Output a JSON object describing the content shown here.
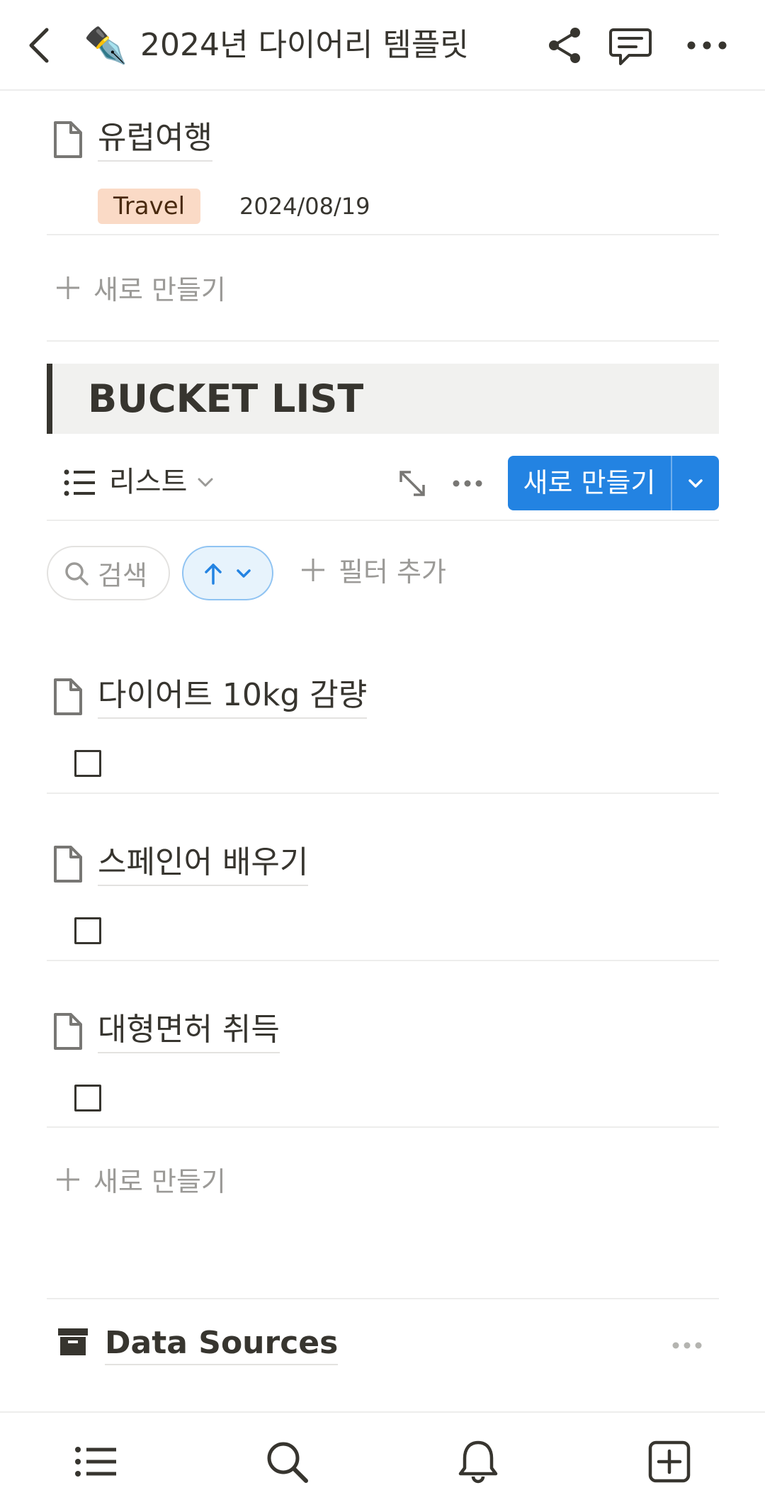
{
  "header": {
    "title": "2024년 다이어리 템플릿",
    "emoji": "✒️",
    "icons": {
      "back": "chevron-left-icon",
      "share": "share-icon",
      "comment": "comment-icon",
      "more": "more-horizontal-icon"
    }
  },
  "previous_item": {
    "title": "유럽여행",
    "tag": "Travel",
    "tag_color": "#fadac6",
    "date": "2024/08/19"
  },
  "new_row_label": "새로 만들기",
  "bucket_list": {
    "heading": "BUCKET LIST",
    "view_label": "리스트",
    "new_button_label": "새로 만들기",
    "search_label": "검색",
    "filter_add_label": "필터 추가",
    "items": [
      {
        "title": "다이어트 10kg 감량",
        "checked": false
      },
      {
        "title": "스페인어 배우기",
        "checked": false
      },
      {
        "title": "대형면허 취득",
        "checked": false
      }
    ],
    "new_row_label": "새로 만들기"
  },
  "data_sources": {
    "title": "Data Sources"
  },
  "bottom_nav": {
    "items": [
      "list-icon",
      "search-icon",
      "bell-icon",
      "add-page-icon"
    ]
  },
  "colors": {
    "accent": "#2383e2",
    "text": "#37352f",
    "muted": "#9b9a97",
    "callout_bg": "#f1f1ef"
  }
}
